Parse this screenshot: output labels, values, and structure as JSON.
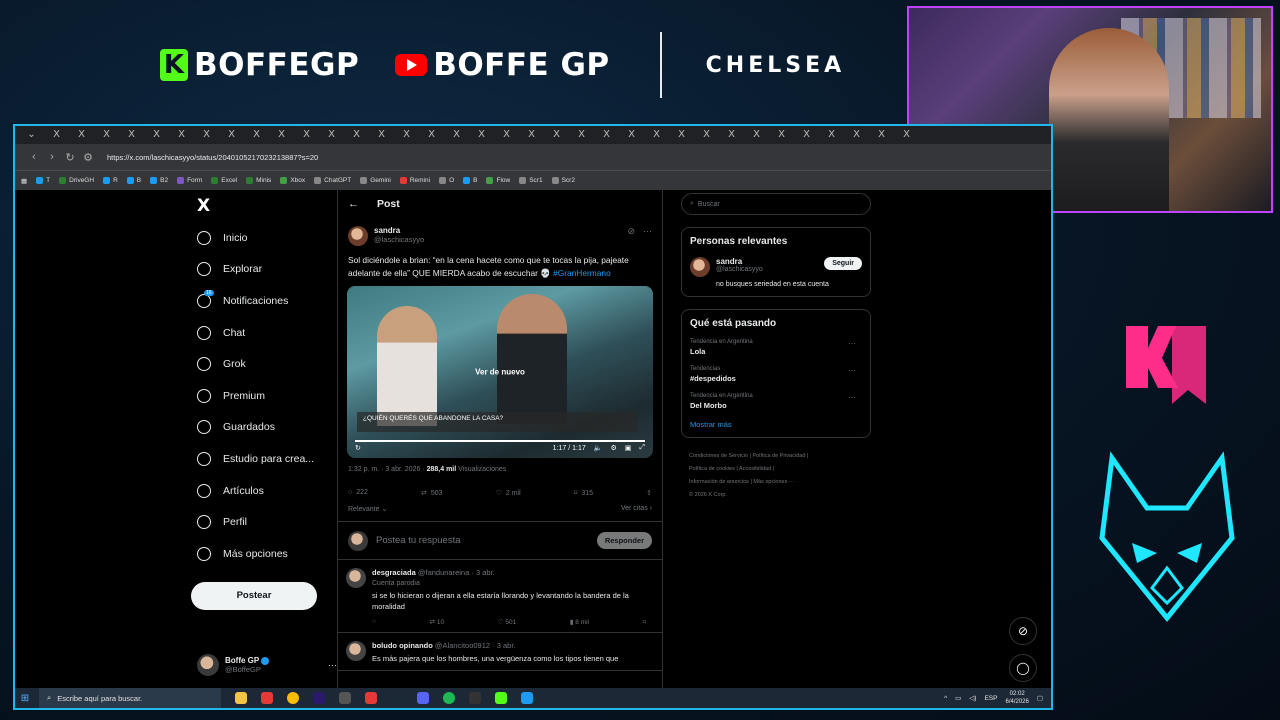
{
  "banner": {
    "kick_label": "BOFFEGP",
    "youtube_label": "BOFFE GP",
    "partner_label": "CHELSEA"
  },
  "browser": {
    "tab_glyph": "X",
    "url": "https://x.com/laschicasyyo/status/2040105217023213887?s=20",
    "bookmarks": [
      {
        "label": "T",
        "color": "#1d9bf0"
      },
      {
        "label": "DriveGH",
        "color": "#2e7d32"
      },
      {
        "label": "R",
        "color": "#1d9bf0"
      },
      {
        "label": "B",
        "color": "#1d9bf0"
      },
      {
        "label": "B2",
        "color": "#1d9bf0"
      },
      {
        "label": "Form",
        "color": "#7e57c2"
      },
      {
        "label": "Excel",
        "color": "#2e7d32"
      },
      {
        "label": "Minis",
        "color": "#2e7d32"
      },
      {
        "label": "Xbox",
        "color": "#43a047"
      },
      {
        "label": "ChatGPT",
        "color": "#888888"
      },
      {
        "label": "Gemini",
        "color": "#888888"
      },
      {
        "label": "Remini",
        "color": "#e53935"
      },
      {
        "label": "O",
        "color": "#888888"
      },
      {
        "label": "B",
        "color": "#1d9bf0"
      },
      {
        "label": "Flow",
        "color": "#43a047"
      },
      {
        "label": "Scr1",
        "color": "#888888"
      },
      {
        "label": "Scr2",
        "color": "#888888"
      }
    ]
  },
  "nav": {
    "logo": "X",
    "items": [
      {
        "label": "Inicio"
      },
      {
        "label": "Explorar"
      },
      {
        "label": "Notificaciones",
        "badge": "16"
      },
      {
        "label": "Chat"
      },
      {
        "label": "Grok"
      },
      {
        "label": "Premium"
      },
      {
        "label": "Guardados"
      },
      {
        "label": "Estudio para crea..."
      },
      {
        "label": "Artículos"
      },
      {
        "label": "Perfil"
      },
      {
        "label": "Más opciones"
      }
    ],
    "post_button": "Postear",
    "account": {
      "name": "Boffe GP",
      "handle": "@BoffeGP"
    }
  },
  "post": {
    "header": "Post",
    "author_name": "sandra",
    "author_handle": "@laschicasyyo",
    "text": "Sol diciéndole a brian: “en la cena hacete como que te tocas la pija, pajeate adelante de ella” QUE MIERDA acabo de escuchar 💀",
    "hashtag": "#GranHermano",
    "video": {
      "replay_label": "Ver de nuevo",
      "time": "1:17 / 1:17",
      "caption": "¿QUIÉN QUERÉS QUE ABANDONE LA CASA?"
    },
    "timestamp": "1:32 p. m. · 3 abr. 2026 ·",
    "views_count": "288,4 mil",
    "views_label": "Visualizaciones",
    "replies": "222",
    "reposts": "503",
    "likes": "2 mil",
    "bookmarks": "315",
    "sort_label": "Relevante",
    "quotes_label": "Ver citas"
  },
  "reply_box": {
    "placeholder": "Postea tu respuesta",
    "button": "Responder"
  },
  "replies": [
    {
      "name": "desgraciada",
      "handle": "@fandunareina · 3 abr.",
      "sub": "Cuenta parodia",
      "text": "si se lo hicieran o dijeran a ella estaría llorando y levantando la bandera de la moralidad",
      "reposts": "10",
      "likes": "501",
      "views": "8 mil"
    },
    {
      "name": "boludo opinando",
      "handle": "@Alancitoo0912 · 3 abr.",
      "sub": "",
      "text": "Es más pajera que los hombres, una vergüenza como los tipos tienen que"
    }
  ],
  "sidebar": {
    "search_placeholder": "Buscar",
    "relevant_title": "Personas relevantes",
    "person": {
      "name": "sandra",
      "handle": "@laschicasyyo",
      "bio": "no busques seriedad en esta cuenta",
      "follow": "Seguir"
    },
    "trending_title": "Qué está pasando",
    "trends": [
      {
        "context": "Tendencia en Argentina",
        "name": "Lola"
      },
      {
        "context": "Tendencias",
        "name": "#despedidos"
      },
      {
        "context": "Tendencia en Argentina",
        "name": "Del Morbo"
      }
    ],
    "show_more": "Mostrar más",
    "footer": [
      "Condiciones de Servicio  |  Política de Privacidad  |",
      "Política de cookies  |  Accesibilidad  |",
      "Información de anuncios  |  Más opciones ···",
      "© 2026 X Corp."
    ]
  },
  "taskbar": {
    "search_placeholder": "Escribe aquí para buscar.",
    "lang": "ESP",
    "time": "02:02",
    "date": "6/4/2026"
  },
  "colors": {
    "accent": "#1d9bf0",
    "frame": "#1fb8e8",
    "webcam_border": "#c043ff",
    "kick_green": "#53fc18"
  }
}
